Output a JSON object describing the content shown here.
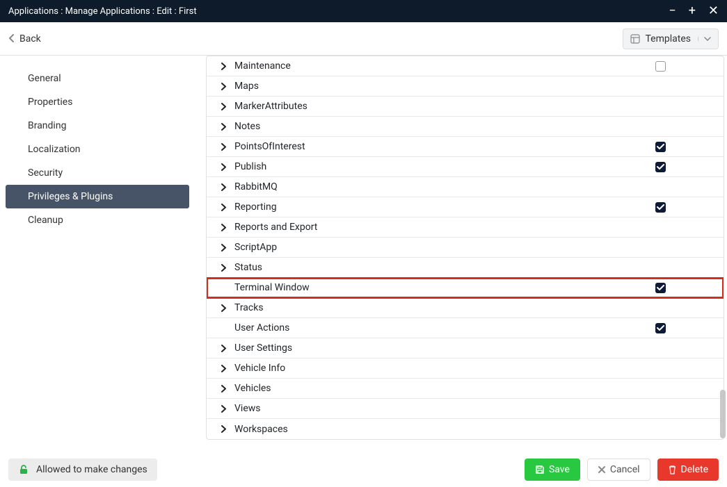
{
  "titlebar": {
    "text": "Applications : Manage Applications : Edit : First"
  },
  "subheader": {
    "back_label": "Back",
    "templates_label": "Templates"
  },
  "sidebar": {
    "items": [
      {
        "label": "General",
        "active": false
      },
      {
        "label": "Properties",
        "active": false
      },
      {
        "label": "Branding",
        "active": false
      },
      {
        "label": "Localization",
        "active": false
      },
      {
        "label": "Security",
        "active": false
      },
      {
        "label": "Privileges & Plugins",
        "active": true
      },
      {
        "label": "Cleanup",
        "active": false
      }
    ]
  },
  "privileges": {
    "rows": [
      {
        "label": "Maintenance",
        "expandable": true,
        "checkbox": "unchecked"
      },
      {
        "label": "Maps",
        "expandable": true,
        "checkbox": "none"
      },
      {
        "label": "MarkerAttributes",
        "expandable": true,
        "checkbox": "none"
      },
      {
        "label": "Notes",
        "expandable": true,
        "checkbox": "none"
      },
      {
        "label": "PointsOfInterest",
        "expandable": true,
        "checkbox": "checked"
      },
      {
        "label": "Publish",
        "expandable": true,
        "checkbox": "checked"
      },
      {
        "label": "RabbitMQ",
        "expandable": true,
        "checkbox": "none"
      },
      {
        "label": "Reporting",
        "expandable": true,
        "checkbox": "checked"
      },
      {
        "label": "Reports and Export",
        "expandable": true,
        "checkbox": "none"
      },
      {
        "label": "ScriptApp",
        "expandable": true,
        "checkbox": "none"
      },
      {
        "label": "Status",
        "expandable": true,
        "checkbox": "none"
      },
      {
        "label": "Terminal Window",
        "expandable": false,
        "checkbox": "checked",
        "highlight": true
      },
      {
        "label": "Tracks",
        "expandable": true,
        "checkbox": "none"
      },
      {
        "label": "User Actions",
        "expandable": false,
        "checkbox": "checked"
      },
      {
        "label": "User Settings",
        "expandable": true,
        "checkbox": "none"
      },
      {
        "label": "Vehicle Info",
        "expandable": true,
        "checkbox": "none"
      },
      {
        "label": "Vehicles",
        "expandable": true,
        "checkbox": "none"
      },
      {
        "label": "Views",
        "expandable": true,
        "checkbox": "none"
      },
      {
        "label": "Workspaces",
        "expandable": true,
        "checkbox": "none"
      }
    ]
  },
  "footer": {
    "allowed_label": "Allowed to make changes",
    "save_label": "Save",
    "cancel_label": "Cancel",
    "delete_label": "Delete"
  }
}
